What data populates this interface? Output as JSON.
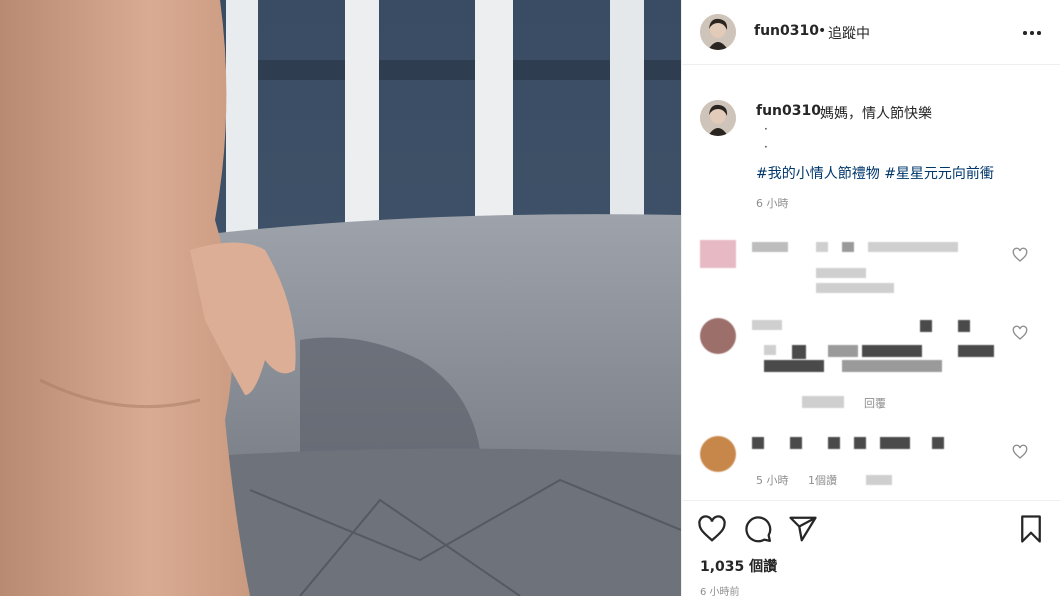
{
  "post": {
    "username": "fun0310",
    "separator": "•",
    "follow_status": "追蹤中",
    "more_icon": "more-horizontal-icon"
  },
  "caption": {
    "username": "fun0310",
    "text": "媽媽，情人節快樂",
    "dots": [
      "·",
      "·"
    ],
    "hashtags": [
      "#我的小情人節禮物",
      "#星星元元向前衝"
    ],
    "time": "6 小時"
  },
  "comments": [
    {
      "meta_time": "",
      "meta_reply": "回覆"
    },
    {
      "meta_time": "5 小時",
      "meta_reply": "1個讚"
    }
  ],
  "actions": {
    "like_icon": "heart-icon",
    "comment_icon": "comment-icon",
    "share_icon": "share-icon",
    "save_icon": "bookmark-icon"
  },
  "likes": "1,035 個讚",
  "post_time": "6 小時前",
  "colors": {
    "link": "#00376b",
    "secondary": "#8e8e8e",
    "text": "#262626"
  }
}
